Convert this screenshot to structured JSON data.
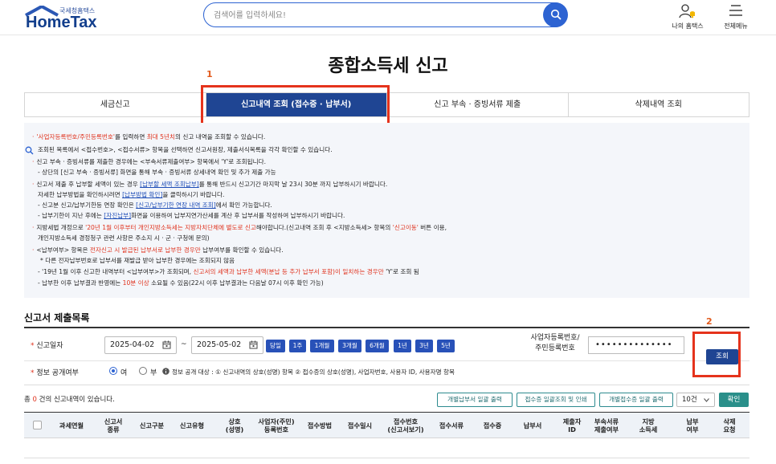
{
  "header": {
    "logo_small": "국세청홈택스",
    "logo_big": "HomeTax",
    "search_placeholder": "검색어를 입력하세요!",
    "my_hometax": "나의 홈택스",
    "all_menu": "전체메뉴"
  },
  "page_title": "종합소득세 신고",
  "annotations": {
    "one": "1",
    "two": "2"
  },
  "tabs": [
    "세금신고",
    "신고내역 조회 (접수증 · 납부서)",
    "신고 부속 · 증빙서류 제출",
    "삭제내역 조회"
  ],
  "notice": {
    "l1a": "'사업자등록번호/주민등록번호'",
    "l1b": "를 입력하면 ",
    "l1c": "최대 5년치",
    "l1d": "의 신고 내역을 조회할 수 있습니다.",
    "l2": "조회된 목록에서 <접수번호>, <접수서류> 항목을 선택하면 신고서원장, 제출서식목록을 각각 확인할 수 있습니다.",
    "l3": "신고 부속 · 증빙서류를 제출한 경우에는 <부속서류제출여부> 항목에서 'Y'로 조회됩니다.",
    "l4": "- 상단의 [신고 부속 · 증빙서류] 화면을 통해 부속 · 증빙서류 상세내역 확인 및 추가 제출 가능",
    "l5a": "신고서 제출 후 납부할 세액이 있는 경우 ",
    "l5b": "[납부할 세액 조회납부]",
    "l5c": "를 통해 반드시 신고기간 마지막 날 23시 30분 까지 납부하시기 바랍니다.",
    "l6a": "자세한 납부방법을 확인하시려면 ",
    "l6b": "[납부방법 확인]",
    "l6c": "을 클릭하시기 바랍니다.",
    "l7a": "- 신고분 신고/납부기한등 연장 확인은 ",
    "l7b": "[신고/납부기한 연장 내역 조회]",
    "l7c": "에서 확인 가능합니다.",
    "l8a": "- 납부기한이 지난 후에는 ",
    "l8b": "[자진납부]",
    "l8c": "화면을 이용하여 납부지연가산세를 계산 후 납부서를 작성하여 납부하시기 바랍니다.",
    "l9a": "지방세법 개정으로 ",
    "l9b": "'20년 1월 이후부터 개인지방소득세는 지방자치단체에 별도로 신고",
    "l9c": "해야합니다.(신고내역 조회 후 <지방소득세> 항목의 ",
    "l9d": "'신고이동'",
    "l9e": " 버튼 이용,",
    "l10": "개인지방소득세 경정청구 관련 사항은 주소지 시 · 군 · 구청에 문의)",
    "l11a": "<납부여부> 항목은 ",
    "l11b": "전자신고 시 발급된 납부서로 납부한 경우만",
    "l11c": " 납부여부를 확인할 수 있습니다.",
    "l12": "* 다른 전자납부번호로 납부서를 재발급 받아 납부한 경우에는 조회되지 않음",
    "l13a": "- '19년 1월 이후 신고한 내역부터 <납부여부>가 조회되며, ",
    "l13b": "신고서의 세액과 납부한 세액(분납 등 추가 납부서 포함)이 일치하는 경우만",
    "l13c": " 'Y'로 조회 됨",
    "l14a": "- 납부한 이후 납부결과 반영에는 ",
    "l14b": "10분 이상",
    "l14c": " 소요될 수 있음(22시 이후 납부결과는 다음날 07시 이후 확인 가능)"
  },
  "section_title": "신고서 제출목록",
  "form": {
    "date_label": "신고일자",
    "date_from": "2025-04-02",
    "tilde": "~",
    "date_to": "2025-05-02",
    "quick": [
      "당일",
      "1주",
      "1개월",
      "3개월",
      "6개월",
      "1년",
      "3년",
      "5년"
    ],
    "id_label": "사업자등록번호/\n주민등록번호",
    "id_value": "••••••••••••••",
    "view_btn": "조회",
    "consent_label": "정보 공개여부",
    "yes": "여",
    "no": "부",
    "consent_note": "정보 공개 대상 : ① 신고내역의 상호(성명) 항목 ② 접수증의 상호(성명), 사업자번호, 사용자 ID, 사용자명 항목"
  },
  "results": {
    "count_prefix": "총 ",
    "count": "0",
    "count_suffix": " 건의 신고내역이 있습니다.",
    "btn1": "개별납부서 일괄 출력",
    "btn2": "접수증 일괄조회 및 인쇄",
    "btn3": "개별접수증 일괄 출력",
    "page_size": "10건",
    "confirm": "확인"
  },
  "columns": [
    "과세연월",
    "신고서\n종류",
    "신고구분",
    "신고유형",
    "상호\n(성명)",
    "사업자(주민)\n등록번호",
    "접수방법",
    "접수일시",
    "접수번호\n(신고서보기)",
    "접수서류",
    "접수증",
    "납부서",
    "제출자\nID",
    "부속서류\n제출여부",
    "지방\n소득세",
    "납부\n여부",
    "삭제\n요청"
  ],
  "colors": {
    "primary": "#1f4593",
    "accent_red": "#e0321d",
    "highlight": "#e5331c",
    "teal": "#2a8f8a"
  }
}
